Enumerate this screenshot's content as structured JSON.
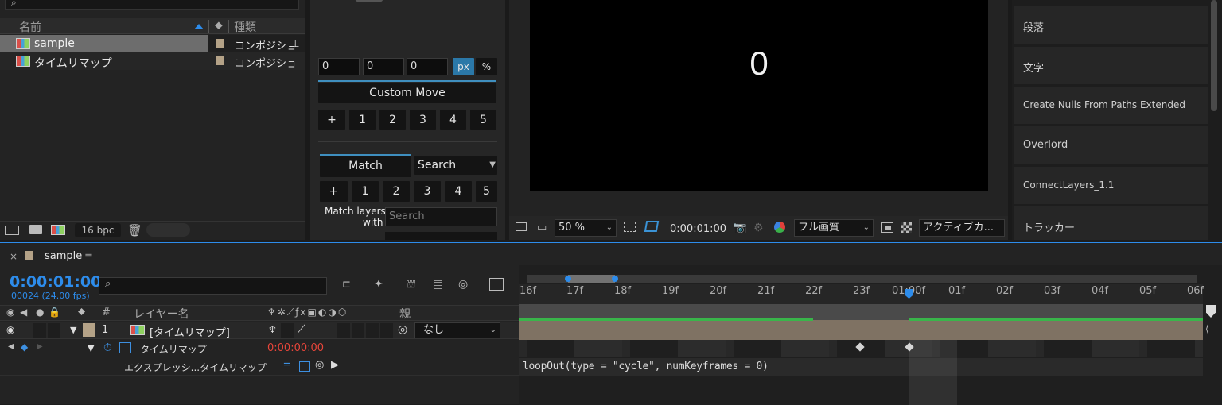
{
  "project": {
    "col_name": "名前",
    "col_type": "種類",
    "items": [
      {
        "name": "sample",
        "type": "コンポジショ",
        "selected": true
      },
      {
        "name": "タイムリマップ",
        "type": "コンポジショ",
        "selected": false
      }
    ],
    "bpc": "16 bpc"
  },
  "mover": {
    "fields": [
      "0",
      "0",
      "0"
    ],
    "unit_px": "px",
    "unit_pct": "%",
    "custom_move": "Custom Move",
    "num_row": [
      "+",
      "1",
      "2",
      "3",
      "4",
      "5"
    ],
    "match_tab": "Match",
    "search_select": "Search",
    "match_layers_line1": "Match layers",
    "match_layers_line2": "with",
    "search_placeholder": "Search"
  },
  "viewer": {
    "preview_text": "0",
    "zoom": "50 %",
    "timecode": "0:00:01:00",
    "quality": "フル画質",
    "camera": "アクティブカ..."
  },
  "right_panel": {
    "items": [
      "段落",
      "文字",
      "Create Nulls From Paths Extended",
      "Overlord",
      "ConnectLayers_1.1",
      "トラッカー"
    ]
  },
  "timeline": {
    "comp_tab": "sample",
    "timecode": "0:00:01:00",
    "frames": "00024 (24.00 fps)",
    "col_num": "#",
    "col_layer": "レイヤー名",
    "col_parent": "親",
    "layer": {
      "num": "1",
      "name": "[タイムリマップ]",
      "parent": "なし"
    },
    "property": {
      "name": "タイムリマップ",
      "value": "0:00:00:00"
    },
    "expression": {
      "label": "エクスプレッシ...タイムリマップ",
      "code": "loopOut(type = \"cycle\", numKeyframes = 0)"
    },
    "ruler": [
      "16f",
      "17f",
      "18f",
      "19f",
      "20f",
      "21f",
      "22f",
      "23f",
      "01:00f",
      "01f",
      "02f",
      "03f",
      "04f",
      "05f",
      "06f"
    ],
    "colors": {
      "accent": "#2d8ceb",
      "timecode_red": "#e5453a",
      "layer_bar": "#7f7263",
      "green": "#39b54a"
    }
  }
}
